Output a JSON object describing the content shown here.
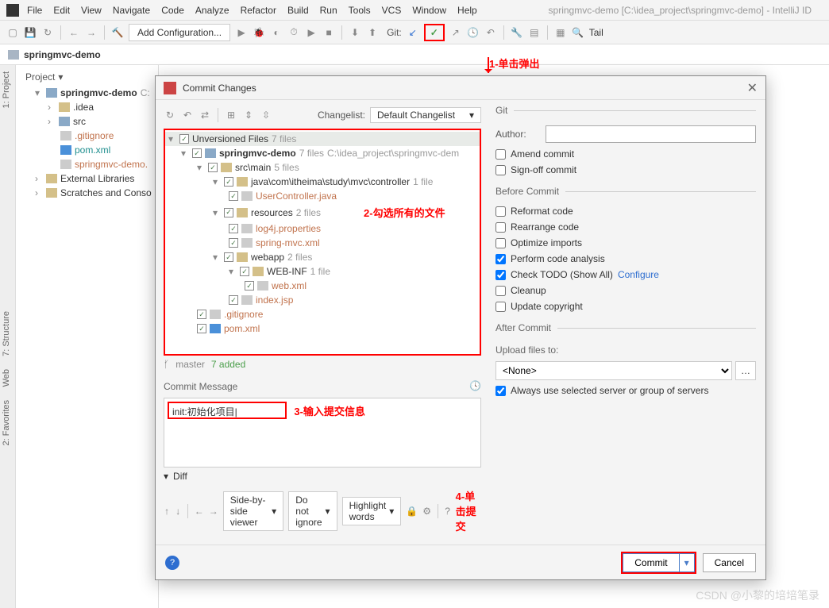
{
  "window": {
    "title": "springmvc-demo [C:\\idea_project\\springmvc-demo] - IntelliJ ID"
  },
  "menu": {
    "file": "File",
    "edit": "Edit",
    "view": "View",
    "navigate": "Navigate",
    "code": "Code",
    "analyze": "Analyze",
    "refactor": "Refactor",
    "build": "Build",
    "run": "Run",
    "tools": "Tools",
    "vcs": "VCS",
    "window": "Window",
    "help": "Help"
  },
  "toolbar": {
    "config": "Add Configuration...",
    "git": "Git:",
    "tail": "Tail"
  },
  "breadcrumb": {
    "root": "springmvc-demo"
  },
  "sidetabs": {
    "project": "1: Project",
    "structure": "7: Structure",
    "web": "Web",
    "fav": "2: Favorites"
  },
  "project_panel": {
    "header": "Project",
    "root": "springmvc-demo",
    "root_hint": "C:",
    "idea": ".idea",
    "src": "src",
    "gitignore": ".gitignore",
    "pom": "pom.xml",
    "iml": "springmvc-demo.",
    "ext": "External Libraries",
    "scratch": "Scratches and Conso"
  },
  "annotations": {
    "a1": "1-单击弹出",
    "a2": "2-勾选所有的文件",
    "a3": "3-输入提交信息",
    "a4": "4-单击提交"
  },
  "dialog": {
    "title": "Commit Changes",
    "changelist_label": "Changelist:",
    "changelist": "Default Changelist",
    "tree": {
      "unversioned": "Unversioned Files",
      "unversioned_count": "7 files",
      "root": "springmvc-demo",
      "root_count": "7 files",
      "root_path": "C:\\idea_project\\springmvc-dem",
      "srcmain": "src\\main",
      "srcmain_count": "5 files",
      "java_path": "java\\com\\itheima\\study\\mvc\\controller",
      "java_count": "1 file",
      "controller": "UserController.java",
      "resources": "resources",
      "resources_count": "2 files",
      "log4j": "log4j.properties",
      "springmvc": "spring-mvc.xml",
      "webapp": "webapp",
      "webapp_count": "2 files",
      "webinf": "WEB-INF",
      "webinf_count": "1 file",
      "webxml": "web.xml",
      "indexjsp": "index.jsp",
      "gitignore": ".gitignore",
      "pom": "pom.xml"
    },
    "branch": "master",
    "added": "7 added",
    "commit_message_label": "Commit Message",
    "commit_message": "init:初始化项目|",
    "diff": "Diff",
    "viewer": "Side-by-side viewer",
    "ignore": "Do not ignore",
    "highlight": "Highlight words",
    "git_section": "Git",
    "author": "Author:",
    "amend": "Amend commit",
    "signoff": "Sign-off commit",
    "before": "Before Commit",
    "reformat": "Reformat code",
    "rearrange": "Rearrange code",
    "optimize": "Optimize imports",
    "analysis": "Perform code analysis",
    "todo": "Check TODO (Show All)",
    "configure": "Configure",
    "cleanup": "Cleanup",
    "copyright": "Update copyright",
    "after": "After Commit",
    "upload": "Upload files to:",
    "none": "<None>",
    "always": "Always use selected server or group of servers",
    "commit_btn": "Commit",
    "cancel_btn": "Cancel"
  },
  "watermark": "CSDN @小黎的培培笔录"
}
